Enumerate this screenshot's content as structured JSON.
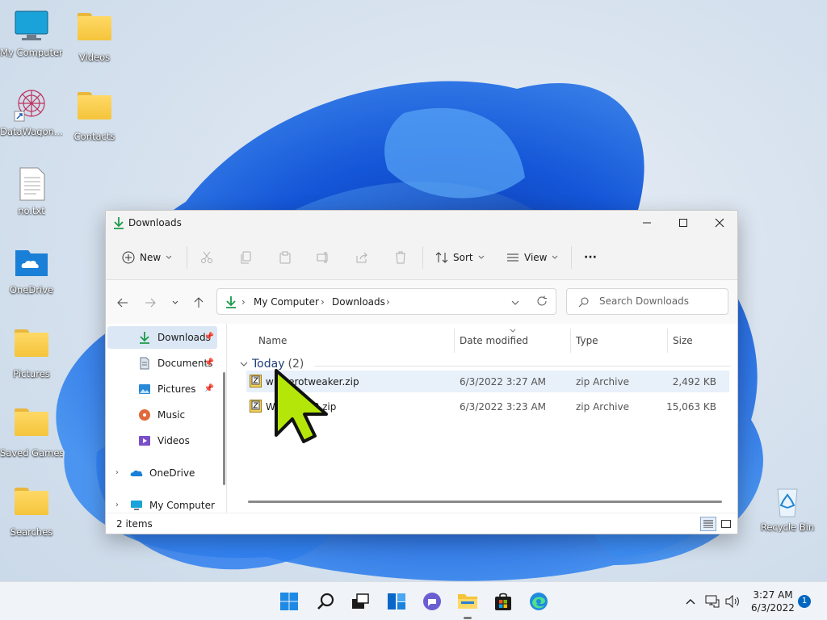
{
  "desktop": {
    "icons": [
      {
        "label": "My Computer"
      },
      {
        "label": "Videos"
      },
      {
        "label": "DataWagon..."
      },
      {
        "label": "Contacts"
      },
      {
        "label": "no.txt"
      },
      {
        "label": "OneDrive"
      },
      {
        "label": "Pictures"
      },
      {
        "label": "Saved Games"
      },
      {
        "label": "Searches"
      },
      {
        "label": "Recycle Bin"
      }
    ]
  },
  "window": {
    "title": "Downloads",
    "toolbar": {
      "new_label": "New",
      "sort_label": "Sort",
      "view_label": "View",
      "more_label": "···"
    },
    "address": {
      "crumbs": [
        "My Computer",
        "Downloads"
      ]
    },
    "search": {
      "placeholder": "Search Downloads"
    },
    "nav": {
      "items": [
        {
          "label": "Downloads",
          "icon": "download-icon"
        },
        {
          "label": "Documents",
          "icon": "documents-icon"
        },
        {
          "label": "Pictures",
          "icon": "pictures-icon"
        },
        {
          "label": "Music",
          "icon": "music-icon"
        },
        {
          "label": "Videos",
          "icon": "videos-icon"
        },
        {
          "label": "OneDrive",
          "icon": "onedrive-icon"
        },
        {
          "label": "My Computer",
          "icon": "computer-icon"
        }
      ]
    },
    "columns": {
      "name": "Name",
      "date": "Date modified",
      "type": "Type",
      "size": "Size"
    },
    "group": {
      "label": "Today",
      "count": "(2)"
    },
    "files": [
      {
        "name": "winaerotweaker.zip",
        "date": "6/3/2022 3:27 AM",
        "type": "zip Archive",
        "size": "2,492 KB",
        "selected": true
      },
      {
        "name": "WinPE10_8.zip",
        "date": "6/3/2022 3:23 AM",
        "type": "zip Archive",
        "size": "15,063 KB",
        "selected": false
      }
    ],
    "status": {
      "items": "2 items"
    }
  },
  "taskbar": {
    "clock_time": "3:27 AM",
    "clock_date": "6/3/2022",
    "notification_count": "1"
  },
  "colors": {
    "accent": "#0067c0",
    "bloom": "#1a5fd4",
    "cursor": "#b4e60a"
  }
}
